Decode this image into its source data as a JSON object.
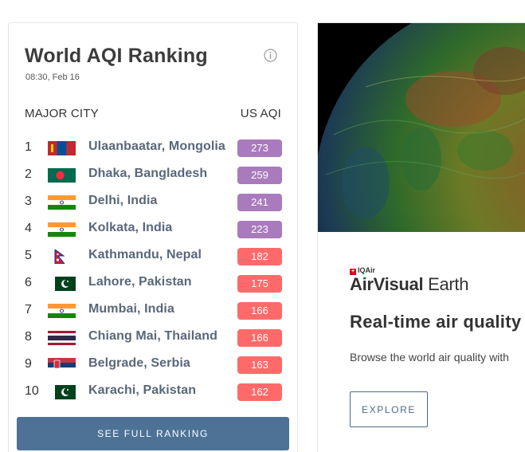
{
  "ranking": {
    "title": "World AQI Ranking",
    "timestamp": "08:30, Feb 16",
    "col_city": "MAJOR CITY",
    "col_aqi": "US AQI",
    "button_label": "SEE FULL RANKING",
    "rows": [
      {
        "rank": "1",
        "city": "Ulaanbaatar, Mongolia",
        "aqi": "273",
        "flag": "mongolia-flag-icon",
        "color": "#a97abc"
      },
      {
        "rank": "2",
        "city": "Dhaka, Bangladesh",
        "aqi": "259",
        "flag": "bangladesh-flag-icon",
        "color": "#a97abc"
      },
      {
        "rank": "3",
        "city": "Delhi, India",
        "aqi": "241",
        "flag": "india-flag-icon",
        "color": "#a97abc"
      },
      {
        "rank": "4",
        "city": "Kolkata, India",
        "aqi": "223",
        "flag": "india-flag-icon",
        "color": "#a97abc"
      },
      {
        "rank": "5",
        "city": "Kathmandu, Nepal",
        "aqi": "182",
        "flag": "nepal-flag-icon",
        "color": "#fe6a69"
      },
      {
        "rank": "6",
        "city": "Lahore, Pakistan",
        "aqi": "175",
        "flag": "pakistan-flag-icon",
        "color": "#fe6a69"
      },
      {
        "rank": "7",
        "city": "Mumbai, India",
        "aqi": "166",
        "flag": "india-flag-icon",
        "color": "#fe6a69"
      },
      {
        "rank": "8",
        "city": "Chiang Mai, Thailand",
        "aqi": "166",
        "flag": "thailand-flag-icon",
        "color": "#fe6a69"
      },
      {
        "rank": "9",
        "city": "Belgrade, Serbia",
        "aqi": "163",
        "flag": "serbia-flag-icon",
        "color": "#fe6a69"
      },
      {
        "rank": "10",
        "city": "Karachi, Pakistan",
        "aqi": "162",
        "flag": "pakistan-flag-icon",
        "color": "#fe6a69"
      }
    ]
  },
  "promo": {
    "brand_small": "IQAir",
    "brand_name_1": "AirVisual",
    "brand_name_2": " Earth",
    "heading": "Real-time air quality",
    "text": "Browse the world air quality with",
    "button_label": "EXPLORE"
  },
  "colors": {
    "button_blue": "#4d7296",
    "aqi_purple": "#a97abc",
    "aqi_red": "#fe6a69"
  }
}
